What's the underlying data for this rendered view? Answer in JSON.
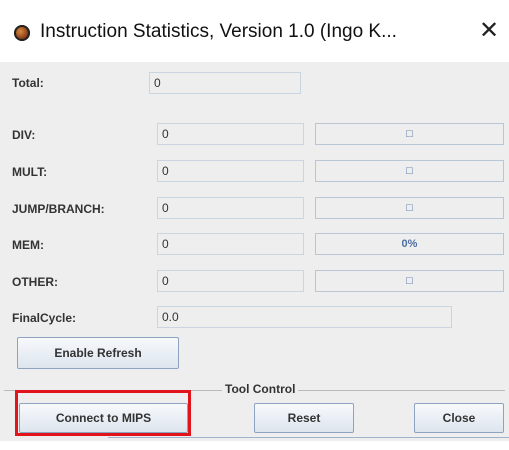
{
  "window": {
    "title": "Instruction Statistics, Version 1.0 (Ingo K...",
    "icon": "mars-app-icon",
    "close_glyph": "✕"
  },
  "stats": [
    {
      "label": "DIV:",
      "value": "0",
      "bar_text": "□",
      "fill_fraction": 0
    },
    {
      "label": "MULT:",
      "value": "0",
      "bar_text": "□",
      "fill_fraction": 0
    },
    {
      "label": "JUMP/BRANCH:",
      "value": "0",
      "bar_text": "□",
      "fill_fraction": 0
    },
    {
      "label": "MEM:",
      "value": "0",
      "bar_text": "0%",
      "fill_fraction": 0
    },
    {
      "label": "OTHER:",
      "value": "0",
      "bar_text": "□",
      "fill_fraction": 0
    }
  ],
  "total": {
    "label": "Total:",
    "value": "0"
  },
  "final_cycle": {
    "label": "FinalCycle:",
    "value": "0.0"
  },
  "buttons": {
    "enable_refresh": "Enable Refresh",
    "connect": "Connect to MIPS",
    "reset": "Reset",
    "close": "Close"
  },
  "tool_control": {
    "title": "Tool Control"
  },
  "colors": {
    "highlight": "#e0141a",
    "progress_text": "#4f6f9f",
    "panel": "#eeeeee"
  }
}
